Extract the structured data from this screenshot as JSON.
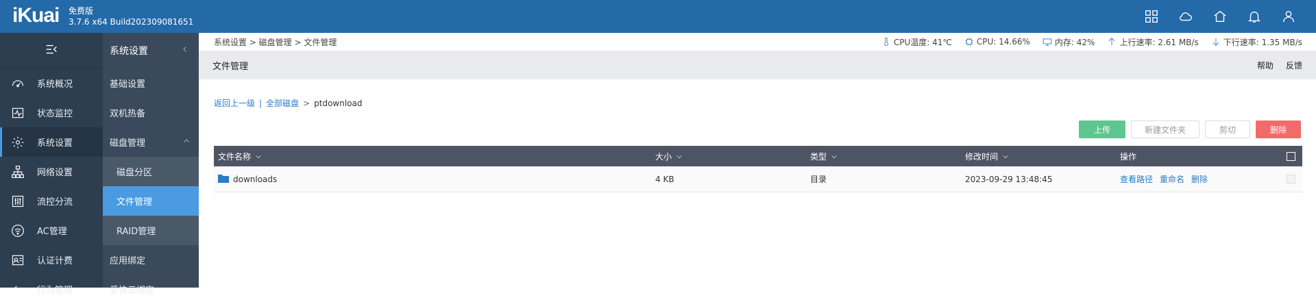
{
  "header": {
    "logo": "iKuai",
    "edition": "免费版",
    "version": "3.7.6 x64 Build202309081651",
    "icons": [
      "apps-grid-icon",
      "cloud-icon",
      "home-icon",
      "bell-icon",
      "user-icon"
    ]
  },
  "sidebar": {
    "items": [
      {
        "label": "系统概况",
        "icon": "dashboard-icon"
      },
      {
        "label": "状态监控",
        "icon": "pulse-icon"
      },
      {
        "label": "系统设置",
        "icon": "gear-icon",
        "active": true
      },
      {
        "label": "网络设置",
        "icon": "network-icon"
      },
      {
        "label": "流控分流",
        "icon": "sliders-icon"
      },
      {
        "label": "AC管理",
        "icon": "wifi-icon"
      },
      {
        "label": "认证计费",
        "icon": "id-card-icon"
      },
      {
        "label": "行为管理",
        "icon": "arrow-left-icon"
      }
    ]
  },
  "subnav": {
    "title": "系统设置",
    "items": [
      {
        "label": "基础设置"
      },
      {
        "label": "双机热备"
      },
      {
        "label": "磁盘管理",
        "expanded": true
      },
      {
        "label": "磁盘分区",
        "sub": true
      },
      {
        "label": "文件管理",
        "sub": true,
        "selected": true
      },
      {
        "label": "RAID管理",
        "sub": true
      },
      {
        "label": "应用绑定"
      },
      {
        "label": "爱快云绑定"
      }
    ]
  },
  "statusbar": {
    "breadcrumb": "系统设置 > 磁盘管理 > 文件管理",
    "cpu_temp": "CPU温度: 41℃",
    "cpu": "CPU: 14.66%",
    "memory": "内存: 42%",
    "upload": "上行速率: 2.61 MB/s",
    "download": "下行速率: 1.35 MB/s"
  },
  "page": {
    "title": "文件管理",
    "help": "帮助",
    "feedback": "反馈"
  },
  "path": {
    "back": "返回上一级",
    "divider": "|",
    "all_disks": "全部磁盘",
    "arrow": ">",
    "current": "ptdownload"
  },
  "toolbar": {
    "upload": "上传",
    "new_folder": "新建文件夹",
    "cut": "剪切",
    "delete": "删除",
    "colors": {
      "upload": "#5ec791",
      "delete": "#f26b6b"
    }
  },
  "table": {
    "headers": {
      "name": "文件名称",
      "size": "大小",
      "type": "类型",
      "modified": "修改时间",
      "actions": "操作"
    },
    "rows": [
      {
        "name": "downloads",
        "size": "4 KB",
        "type": "目录",
        "modified": "2023-09-29 13:48:45",
        "actions": [
          "查看路径",
          "重命名",
          "删除"
        ]
      }
    ]
  }
}
